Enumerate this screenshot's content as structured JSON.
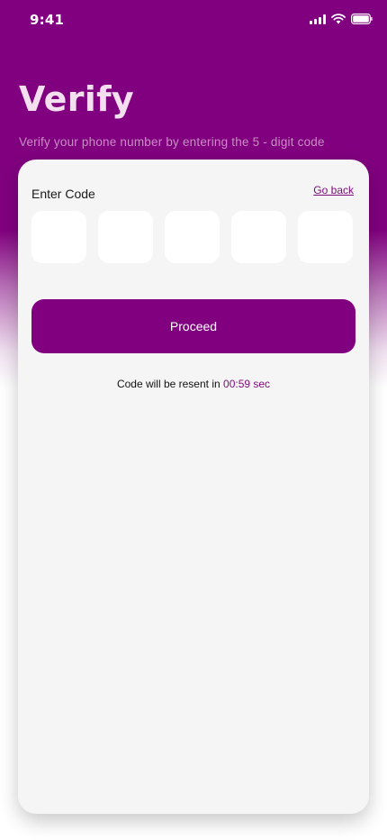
{
  "status_bar": {
    "time": "9:41",
    "icons": [
      "signal-icon",
      "wifi-icon",
      "battery-icon"
    ]
  },
  "header": {
    "title": "Verify",
    "subtitle": "Verify your phone number by entering the 5 - digit code"
  },
  "form": {
    "code_label": "Enter Code",
    "go_back": "Go back",
    "code_digits": [
      "",
      "",
      "",
      "",
      ""
    ],
    "proceed_label": "Proceed",
    "resend_text": "Code will be resent in",
    "resend_timer": "00:59 sec"
  },
  "colors": {
    "brand": "#800080",
    "card": "#f5f5f5"
  }
}
